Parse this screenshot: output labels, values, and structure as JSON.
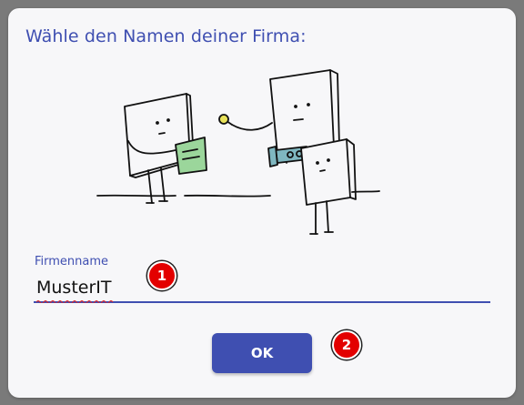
{
  "dialog": {
    "title": "Wähle den Namen deiner Firma:"
  },
  "illustration": {
    "icon": "characters-interview-illustration-icon",
    "colors": {
      "clipboard": "#9bd69b",
      "microphone": "#e8e25a",
      "camera": "#7fb7c0"
    }
  },
  "form": {
    "field_label": "Firmenname",
    "field_value": "MusterIT"
  },
  "actions": {
    "ok_label": "OK"
  },
  "annotations": {
    "marker_1": "1",
    "marker_2": "2",
    "color": "#e30000"
  }
}
